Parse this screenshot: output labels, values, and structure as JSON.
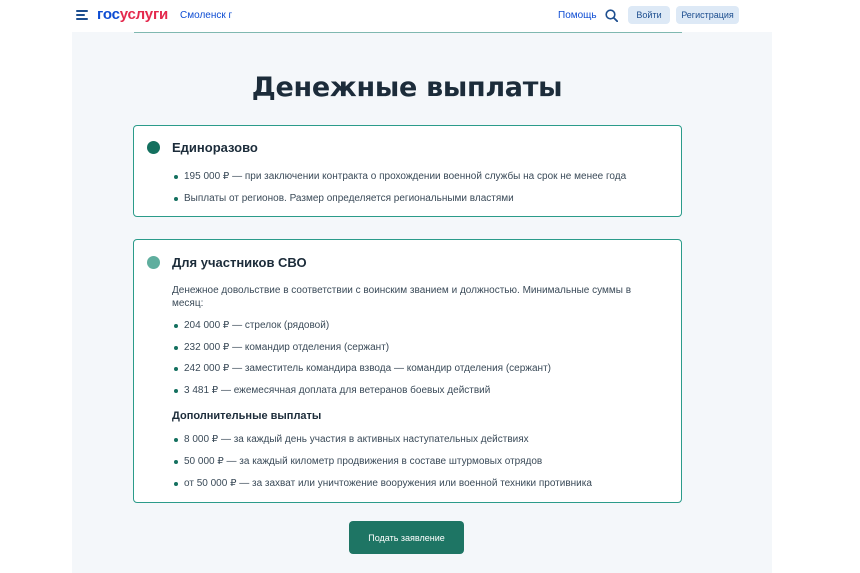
{
  "header": {
    "logo_gos": "гос",
    "logo_uslugi": "услуги",
    "city": "Смоленск г",
    "help": "Помощь",
    "login": "Войти",
    "register": "Регистрация"
  },
  "main": {
    "title": "Денежные выплаты",
    "cards": [
      {
        "title": "Единоразово",
        "items": [
          "195 000 ₽ — при заключении контракта о прохождении военной службы на срок не менее года",
          "Выплаты от регионов. Размер определяется региональными властями"
        ]
      },
      {
        "title": "Для участников СВО",
        "description": "Денежное довольствие в соответствии с воинским званием и должностью. Минимальные суммы в месяц:",
        "items": [
          "204 000 ₽ — стрелок (рядовой)",
          "232 000 ₽ — командир отделения (сержант)",
          "242 000 ₽ — заместитель командира взвода — командир отделения (сержант)",
          "3 481 ₽ — ежемесячная доплата для ветеранов боевых действий"
        ],
        "subtitle": "Дополнительные выплаты",
        "extra_items": [
          "8 000 ₽ — за каждый день участия в активных наступательных действиях",
          "50 000 ₽ — за каждый километр продвижения в составе штурмовых отрядов",
          "от 50 000 ₽ — за захват или уничтожение вооружения или военной техники противника"
        ]
      }
    ],
    "submit": "Подать заявление"
  },
  "colors": {
    "accent": "#1e7564",
    "card_border": "#2b9b8a",
    "link": "#0d4cd3",
    "logo_red": "#e4294d"
  }
}
